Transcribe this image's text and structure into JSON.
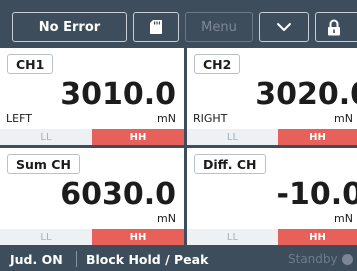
{
  "toolbar": {
    "error_label": "No Error",
    "menu_label": "Menu",
    "sd_icon": "sd-card-icon",
    "chevron_icon": "chevron-down-icon",
    "lock_icon": "lock-icon"
  },
  "channels": [
    {
      "tag": "CH1",
      "value": "3010.0",
      "unit": "mN",
      "side": "LEFT",
      "ll": "LL",
      "hh": "HH"
    },
    {
      "tag": "CH2",
      "value": "3020.0",
      "unit": "mN",
      "side": "RIGHT",
      "ll": "LL",
      "hh": "HH"
    },
    {
      "tag": "Sum CH",
      "value": "6030.0",
      "unit": "mN",
      "side": "",
      "ll": "LL",
      "hh": "HH"
    },
    {
      "tag": "Diff. CH",
      "value": "-10.0",
      "unit": "mN",
      "side": "",
      "ll": "LL",
      "hh": "HH"
    }
  ],
  "status": {
    "judgment": "Jud. ON",
    "mode": "Block Hold / Peak",
    "standby": "Standby"
  },
  "colors": {
    "background": "#3e4d5c",
    "hh_active": "#e8605a",
    "ll_inactive": "#eef1f3"
  }
}
